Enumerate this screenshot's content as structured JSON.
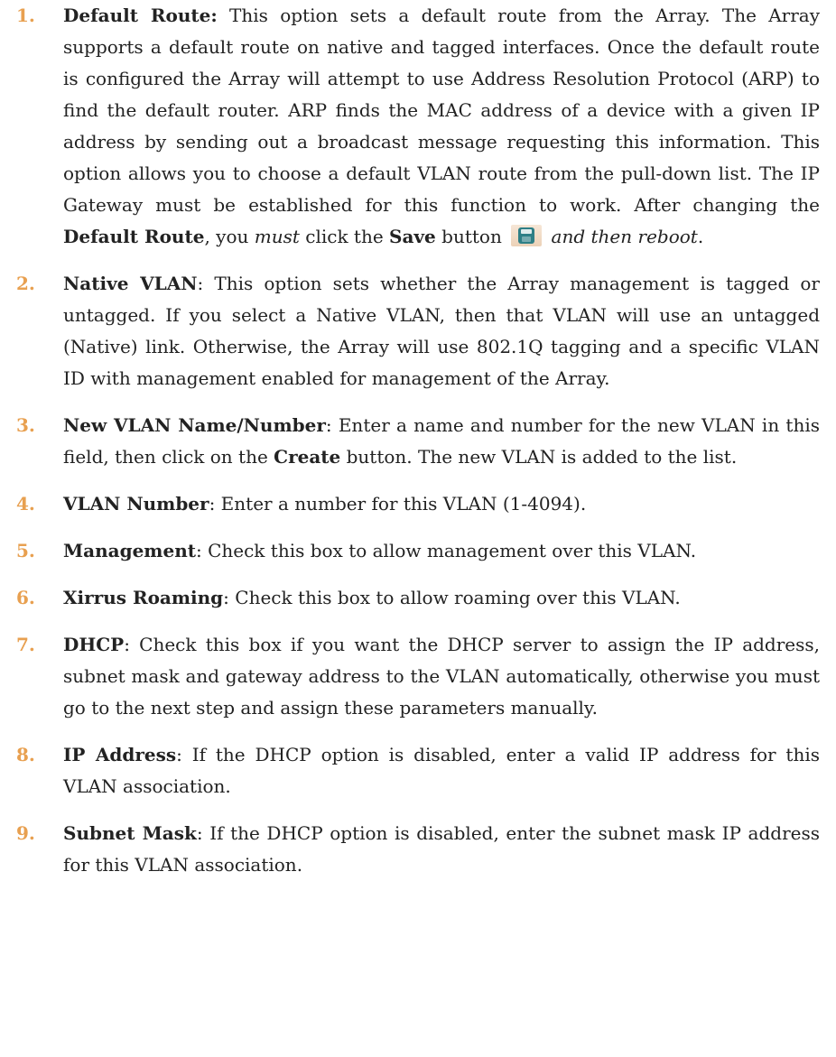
{
  "steps": [
    {
      "number": "1.",
      "parts": [
        {
          "t": "Default Route:",
          "s": "bold"
        },
        {
          "t": " This option sets a default route from the Array. The Array supports a default route on native and tagged interfaces. Once the default route is configured the Array will attempt to use Address Resolution Protocol (ARP) to find the default router. ARP finds the MAC address of a device with a given IP address by sending out a broadcast message requesting this information. This option allows you to choose a default VLAN route from the pull-down list. The IP Gateway must be established for this function to work. After changing the "
        },
        {
          "t": "Default Route",
          "s": "bold"
        },
        {
          "t": ", you "
        },
        {
          "t": "must",
          "s": "italic"
        },
        {
          "t": " click the "
        },
        {
          "t": "Save",
          "s": "bold"
        },
        {
          "t": " button "
        },
        {
          "icon": "save-icon"
        },
        {
          "t": " "
        },
        {
          "t": "and then reboot",
          "s": "italic"
        },
        {
          "t": "."
        }
      ]
    },
    {
      "number": "2.",
      "parts": [
        {
          "t": "Native VLAN",
          "s": "bold"
        },
        {
          "t": ": This option sets whether the Array management is tagged or untagged. If you select a Native VLAN, then that VLAN will use an untagged (Native) link. Otherwise, the Array will use 802.1Q tagging and a specific VLAN ID with management enabled for management of the Array."
        }
      ]
    },
    {
      "number": "3.",
      "parts": [
        {
          "t": "New VLAN Name/Number",
          "s": "bold"
        },
        {
          "t": ": Enter a name and number for the new VLAN in this field, then click on the "
        },
        {
          "t": "Create",
          "s": "bold"
        },
        {
          "t": " button. The new VLAN is added to the list."
        }
      ]
    },
    {
      "number": "4.",
      "parts": [
        {
          "t": "VLAN Number",
          "s": "bold"
        },
        {
          "t": ": Enter a number for this VLAN (1-4094)."
        }
      ]
    },
    {
      "number": "5.",
      "parts": [
        {
          "t": "Management",
          "s": "bold"
        },
        {
          "t": ": Check this box to allow management over this VLAN."
        }
      ]
    },
    {
      "number": "6.",
      "parts": [
        {
          "t": "Xirrus Roaming",
          "s": "bold"
        },
        {
          "t": ": Check this box to allow roaming over this VLAN."
        }
      ]
    },
    {
      "number": "7.",
      "parts": [
        {
          "t": "DHCP",
          "s": "bold"
        },
        {
          "t": ": Check this box if you want the DHCP server to assign the IP address, subnet mask and gateway address to the VLAN automatically, otherwise you must go to the next step and assign these parameters manually."
        }
      ]
    },
    {
      "number": "8.",
      "parts": [
        {
          "t": "IP Address",
          "s": "bold"
        },
        {
          "t": ": If the DHCP option is disabled, enter a valid IP address for this VLAN association."
        }
      ]
    },
    {
      "number": "9.",
      "parts": [
        {
          "t": "Subnet Mask",
          "s": "bold"
        },
        {
          "t": ": If the DHCP option is disabled, enter the subnet mask IP address for this VLAN association."
        }
      ]
    }
  ],
  "colors": {
    "step_number": "#e8a050",
    "body_text": "#222222",
    "save_icon_fill": "#2e7f86"
  }
}
